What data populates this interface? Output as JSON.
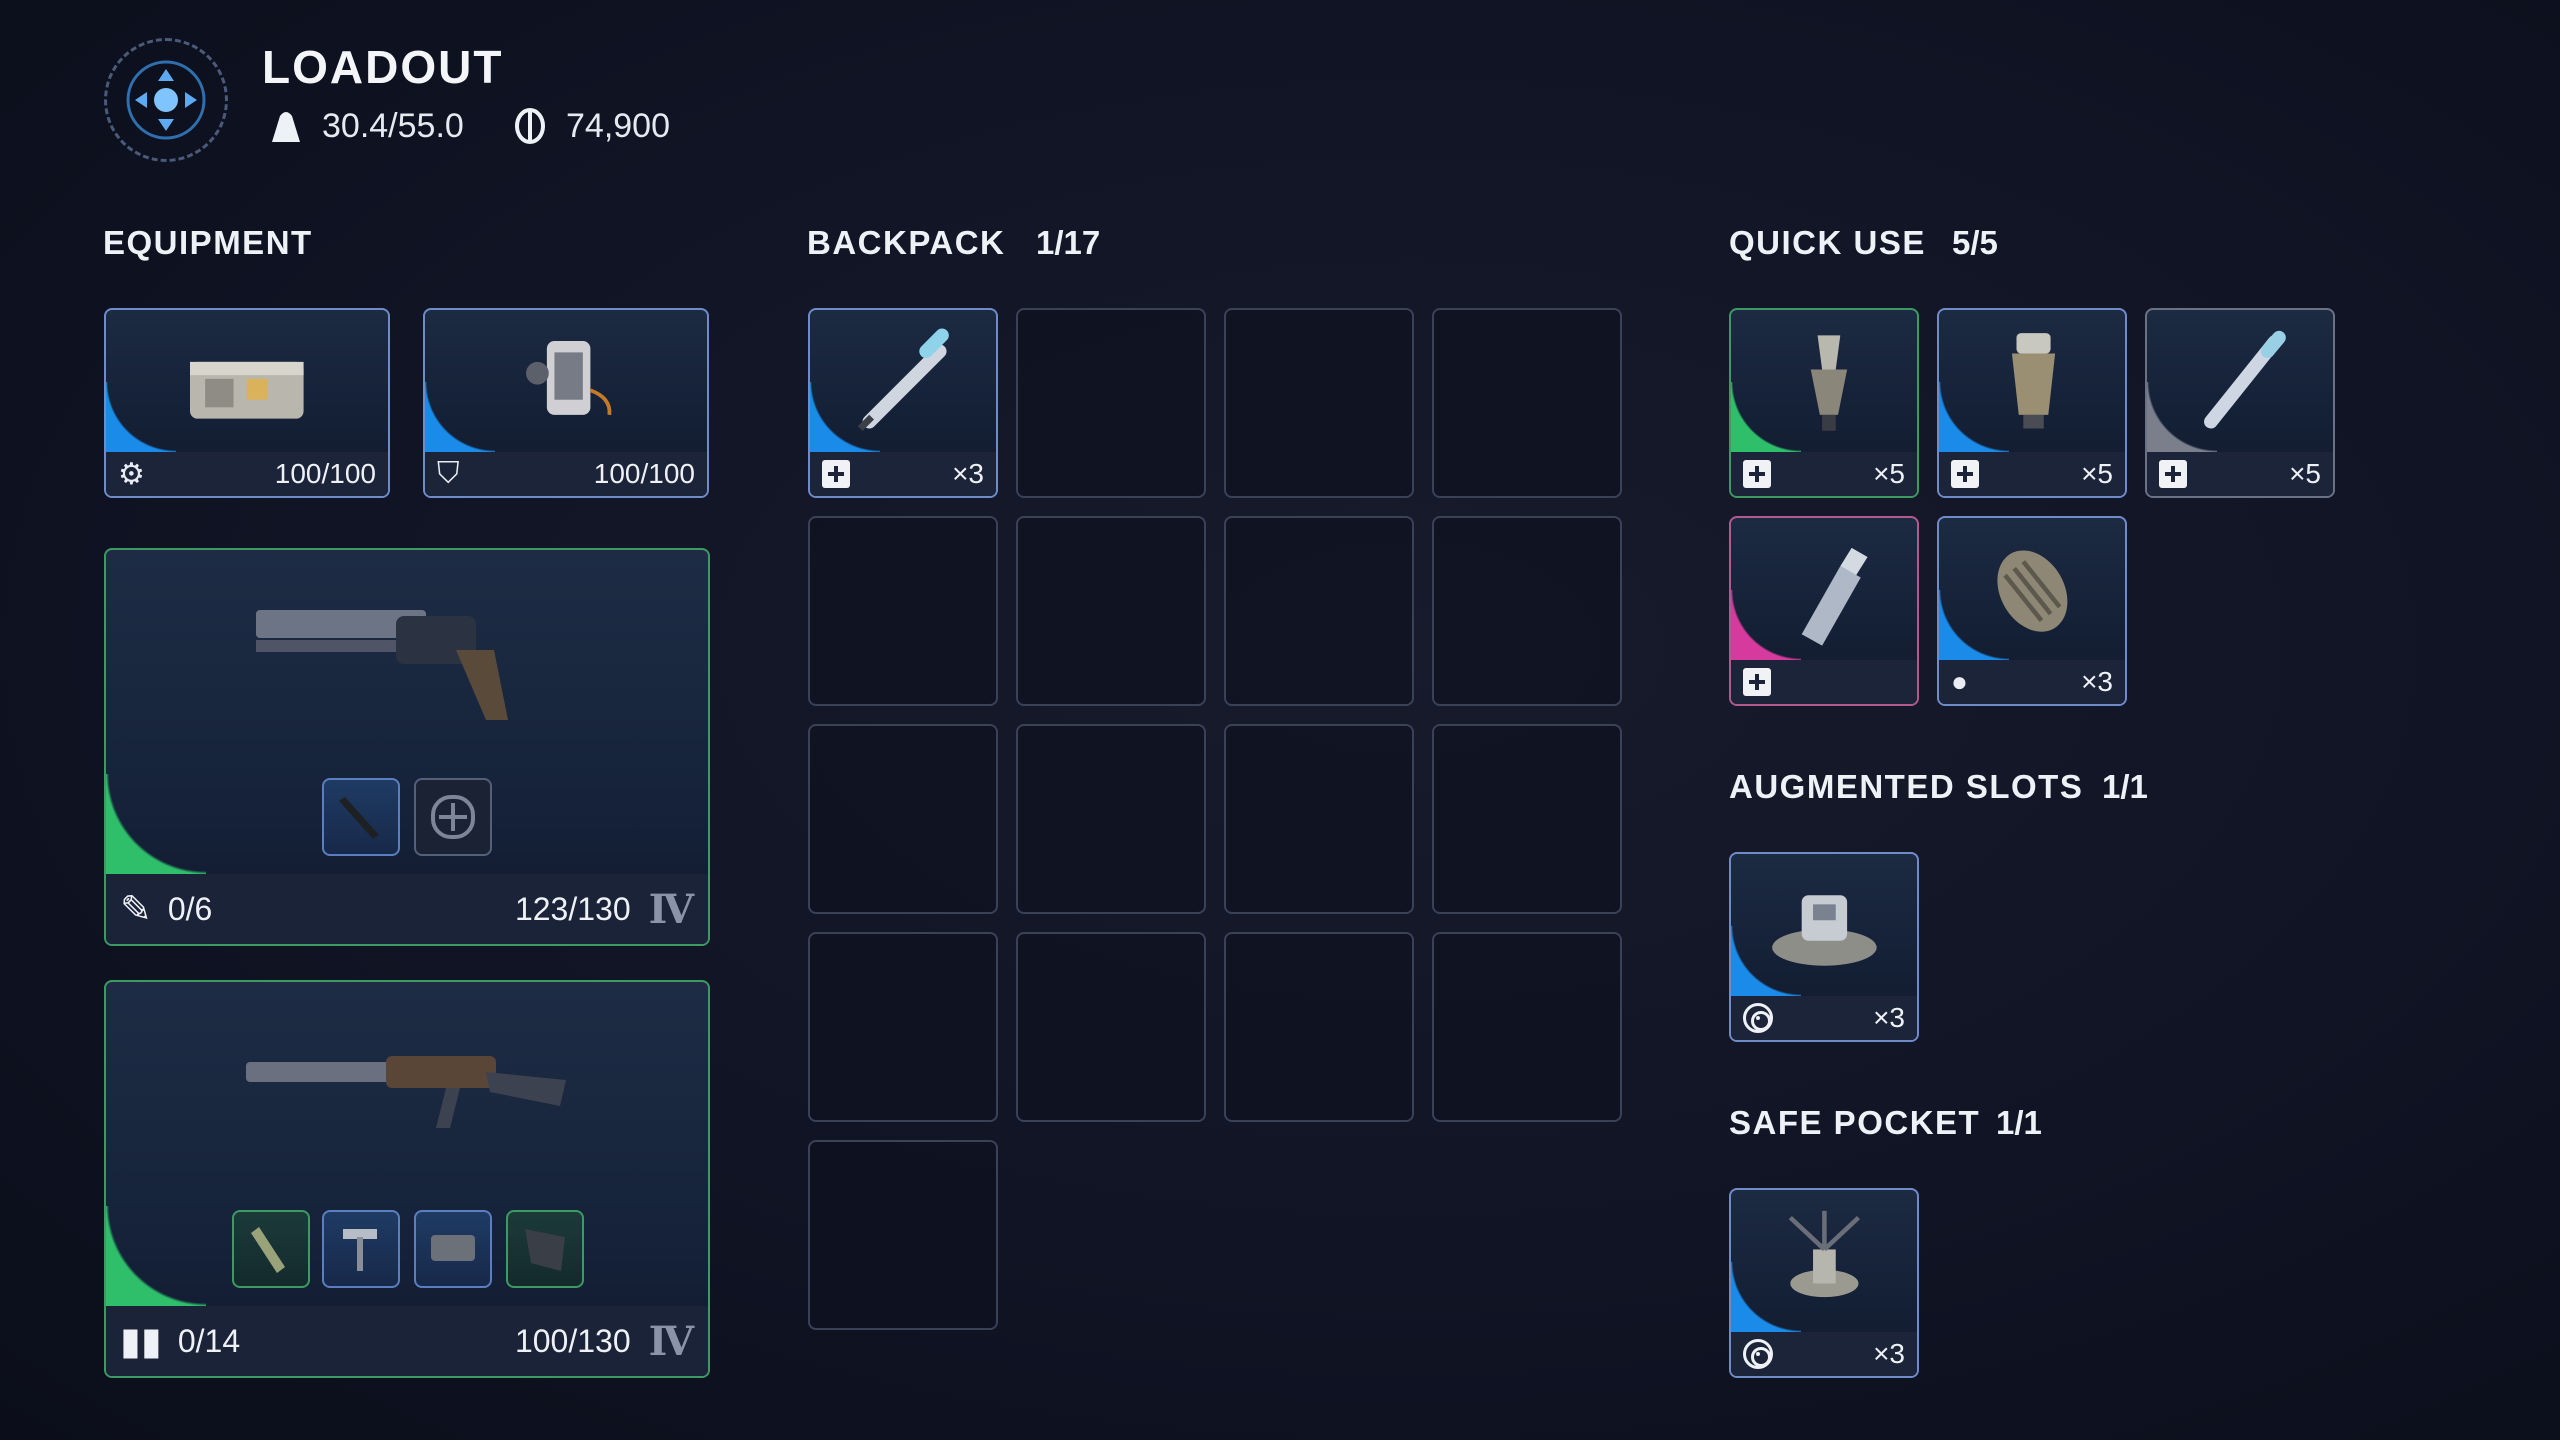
{
  "header": {
    "title": "LOADOUT",
    "weight": "30.4/55.0",
    "credits": "74,900"
  },
  "equipment": {
    "label": "EQUIPMENT",
    "slots": [
      {
        "name": "augment-case",
        "icon": "augment-icon",
        "durability": "100/100",
        "rarity_color": "#1a8be8"
      },
      {
        "name": "shield",
        "icon": "shield-icon",
        "durability": "100/100",
        "rarity_color": "#1a8be8"
      }
    ],
    "weapons": [
      {
        "name": "revolver",
        "ammo_icon": "bullet-icon",
        "ammo": "0/6",
        "durability": "123/130",
        "tier": "Ⅳ",
        "rarity_color": "#2fbf6a"
      },
      {
        "name": "rifle",
        "ammo_icon": "magazine-icon",
        "ammo": "0/14",
        "durability": "100/130",
        "tier": "Ⅳ",
        "rarity_color": "#2fbf6a"
      }
    ]
  },
  "backpack": {
    "label": "BACKPACK",
    "count": "1/17",
    "items": [
      {
        "name": "syringe",
        "icon": "plus-icon",
        "qty": "×3",
        "rarity_color": "#1a8be8"
      }
    ]
  },
  "quick_use": {
    "label": "QUICK USE",
    "count": "5/5",
    "items": [
      {
        "name": "bandage-injector",
        "icon": "plus-icon",
        "qty": "×5",
        "rarity_color": "#2fbf6a"
      },
      {
        "name": "medkit-canister",
        "icon": "plus-icon",
        "qty": "×5",
        "rarity_color": "#1a8be8"
      },
      {
        "name": "stim-syringe",
        "icon": "plus-icon",
        "qty": "×5",
        "rarity_color": "#7b7f8c"
      },
      {
        "name": "oxygen-bottle",
        "icon": "plus-icon",
        "qty": "",
        "rarity_color": "#d63a9c"
      },
      {
        "name": "grenade",
        "icon": "grenade-icon",
        "qty": "×3",
        "rarity_color": "#1a8be8"
      }
    ]
  },
  "augmented": {
    "label": "AUGMENTED SLOTS",
    "count": "1/1",
    "items": [
      {
        "name": "mine-device",
        "icon": "target-icon",
        "qty": "×3",
        "rarity_color": "#1a8be8"
      }
    ]
  },
  "safe_pocket": {
    "label": "SAFE POCKET",
    "count": "1/1",
    "items": [
      {
        "name": "tripod-device",
        "icon": "target-icon",
        "qty": "×3",
        "rarity_color": "#1a8be8"
      }
    ]
  }
}
